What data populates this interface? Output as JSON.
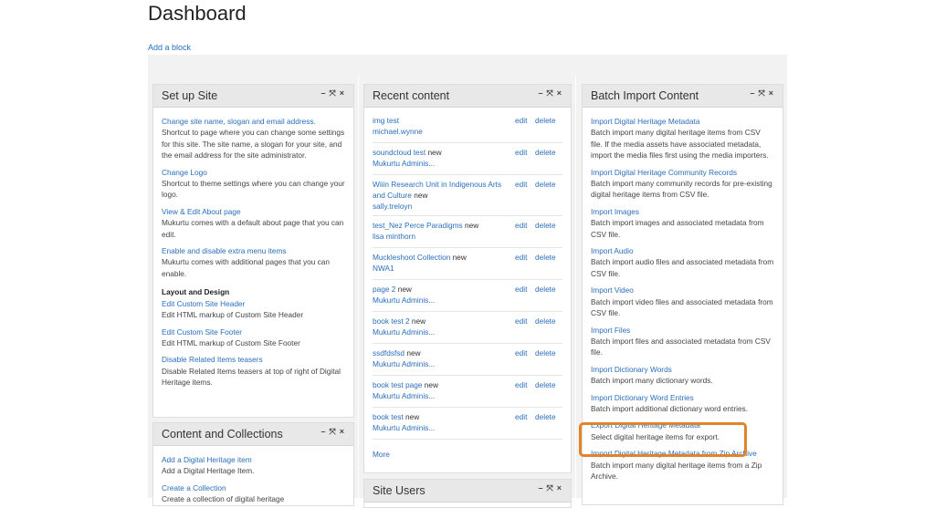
{
  "page": {
    "title": "Dashboard",
    "add_block": "Add a block"
  },
  "controls": {
    "minimize": "–",
    "move": "⤧",
    "close": "×"
  },
  "setup_site": {
    "title": "Set up Site",
    "items": [
      {
        "link": "Change site name, slogan and email address.",
        "desc": "Shortcut to page where you can change some settings for this site. The site name, a slogan for your site, and the email address for the site administrator."
      },
      {
        "link": "Change Logo",
        "desc": "Shortcut to theme settings where you can change your logo."
      },
      {
        "link": "View & Edit About page",
        "desc": "Mukurtu comes with a default about page that you can edit."
      },
      {
        "link": "Enable and disable extra menu items",
        "desc": "Mukurtu comes with additional pages that you can enable."
      }
    ],
    "layout_heading": "Layout and Design",
    "layout_items": [
      {
        "link": "Edit Custom Site Header",
        "desc": "Edit HTML markup of Custom Site Header"
      },
      {
        "link": "Edit Custom Site Footer",
        "desc": "Edit HTML markup of Custom Site Footer"
      },
      {
        "link": "Disable Related Items teasers",
        "desc": "Disable Related Items teasers at top of right of Digital Heritage items."
      }
    ]
  },
  "content_collections": {
    "title": "Content and Collections",
    "items": [
      {
        "link": "Add a Digital Heritage item",
        "desc": "Add a Digital Heritage Item."
      },
      {
        "link": "Create a Collection",
        "desc": "Create a collection of digital heritage"
      }
    ]
  },
  "recent_content": {
    "title": "Recent content",
    "edit_label": "edit",
    "delete_label": "delete",
    "rows": [
      {
        "title": "img test",
        "new": "",
        "author": "michael.wynne"
      },
      {
        "title": "soundcloud test",
        "new": "new",
        "author": "Mukurtu Adminis..."
      },
      {
        "title": "Wiiin Research Unit in Indigenous Arts and Culture",
        "new": "new",
        "author": "sally.treloyn"
      },
      {
        "title": "test_Nez Perce Paradigms",
        "new": "new",
        "author": "lisa minthorn"
      },
      {
        "title": "Muckleshoot Collection",
        "new": "new",
        "author": "NWA1"
      },
      {
        "title": "page 2",
        "new": "new",
        "author": "Mukurtu Adminis..."
      },
      {
        "title": "book test 2",
        "new": "new",
        "author": "Mukurtu Adminis..."
      },
      {
        "title": "ssdfdsfsd",
        "new": "new",
        "author": "Mukurtu Adminis..."
      },
      {
        "title": "book test page",
        "new": "new",
        "author": "Mukurtu Adminis..."
      },
      {
        "title": "book test",
        "new": "new",
        "author": "Mukurtu Adminis..."
      }
    ],
    "more": "More"
  },
  "site_users": {
    "title": "Site Users"
  },
  "batch_import": {
    "title": "Batch Import Content",
    "items": [
      {
        "link": "Import Digital Heritage Metadata",
        "desc": "Batch import many digital heritage items from CSV file. If the media assets have associated metadata, import the media files first using the media importers."
      },
      {
        "link": "Import Digital Heritage Community Records",
        "desc": "Batch import many community records for pre-existing digital heritage items from CSV file."
      },
      {
        "link": "Import Images",
        "desc": "Batch import images and associated metadata from CSV file."
      },
      {
        "link": "Import Audio",
        "desc": "Batch import audio files and associated metadata from CSV file."
      },
      {
        "link": "Import Video",
        "desc": "Batch import video files and associated metadata from CSV file."
      },
      {
        "link": "Import Files",
        "desc": "Batch import files and associated metadata from CSV file."
      },
      {
        "link": "Import Dictionary Words",
        "desc": "Batch import many dictionary words."
      },
      {
        "link": "Import Dictionary Word Entries",
        "desc": "Batch import additional dictionary word entries."
      },
      {
        "link": "Export Digital Heritage Metadata",
        "desc": "Select digital heritage items for export."
      },
      {
        "link": "Import Digital Heritage Metadata from Zip Archive",
        "desc": "Batch import many digital heritage items from a Zip Archive."
      }
    ]
  },
  "colors": {
    "link": "#2a6ebb",
    "highlight": "#e0832a",
    "header_bg": "#e8e8e8"
  }
}
